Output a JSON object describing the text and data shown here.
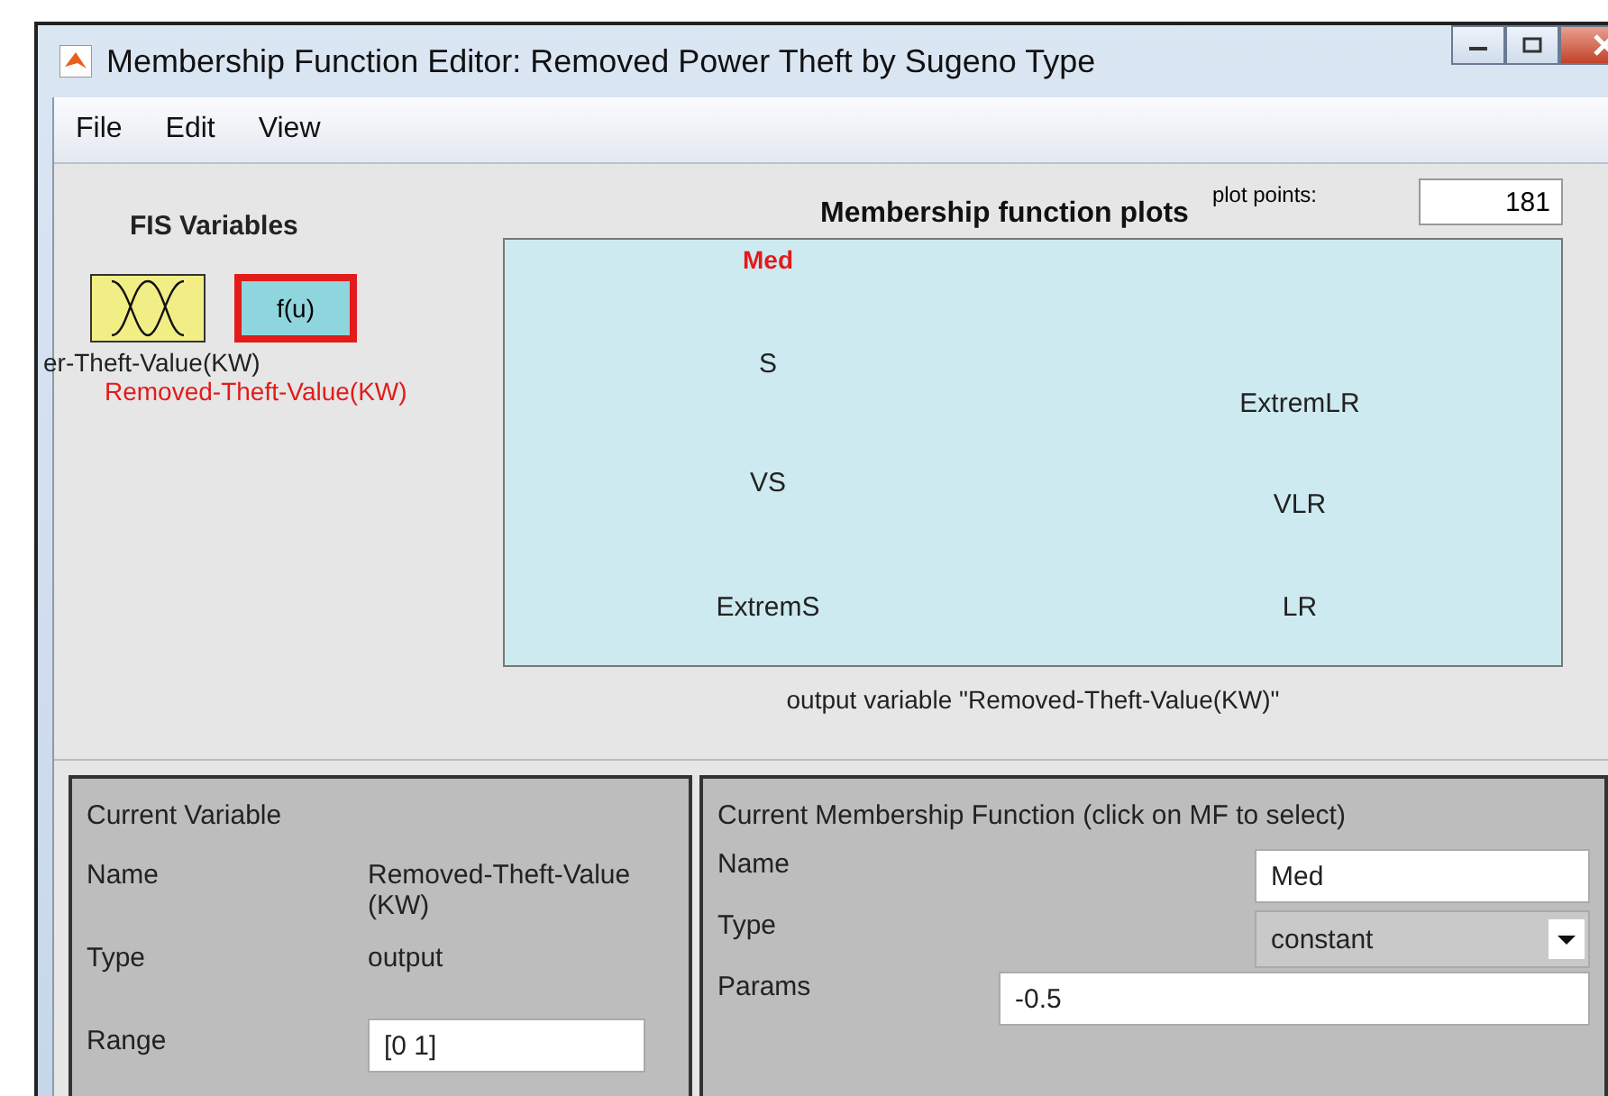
{
  "window": {
    "title": "Membership Function Editor: Removed Power Theft by Sugeno Type"
  },
  "menu": [
    {
      "label": "File"
    },
    {
      "label": "Edit"
    },
    {
      "label": "View"
    }
  ],
  "fis_variables": {
    "title": "FIS Variables",
    "items": [
      {
        "kind": "input",
        "caption": "er-Theft-Value(KW)",
        "selected": false
      },
      {
        "kind": "output",
        "glyph": "f(u)",
        "caption": "Removed-Theft-Value(KW)",
        "selected": true
      }
    ]
  },
  "plot": {
    "title": "Membership function plots",
    "points_label": "plot points:",
    "points": "181",
    "caption": "output variable \"Removed-Theft-Value(KW)\"",
    "mfs": [
      {
        "label": "Med",
        "selected": true
      },
      {
        "label": "S",
        "selected": false
      },
      {
        "label": "VS",
        "selected": false
      },
      {
        "label": "ExtremS",
        "selected": false
      },
      {
        "label": "ExtremLR",
        "selected": false
      },
      {
        "label": "VLR",
        "selected": false
      },
      {
        "label": "LR",
        "selected": false
      }
    ]
  },
  "current_variable": {
    "title": "Current Variable",
    "rows": [
      {
        "kind": "text",
        "label": "Name",
        "value": "Removed-Theft-Value(KW)"
      },
      {
        "kind": "text",
        "label": "Type",
        "value": "output"
      },
      {
        "kind": "field",
        "label": "Range",
        "value": "[0 1]"
      }
    ]
  },
  "current_mf": {
    "title": "Current Membership Function (click on MF to select)",
    "rows": [
      {
        "kind": "field",
        "label": "Name",
        "value": "Med"
      },
      {
        "kind": "dropdown",
        "label": "Type",
        "value": "constant"
      },
      {
        "kind": "wide-field",
        "label": "Params",
        "value": "-0.5"
      }
    ]
  }
}
